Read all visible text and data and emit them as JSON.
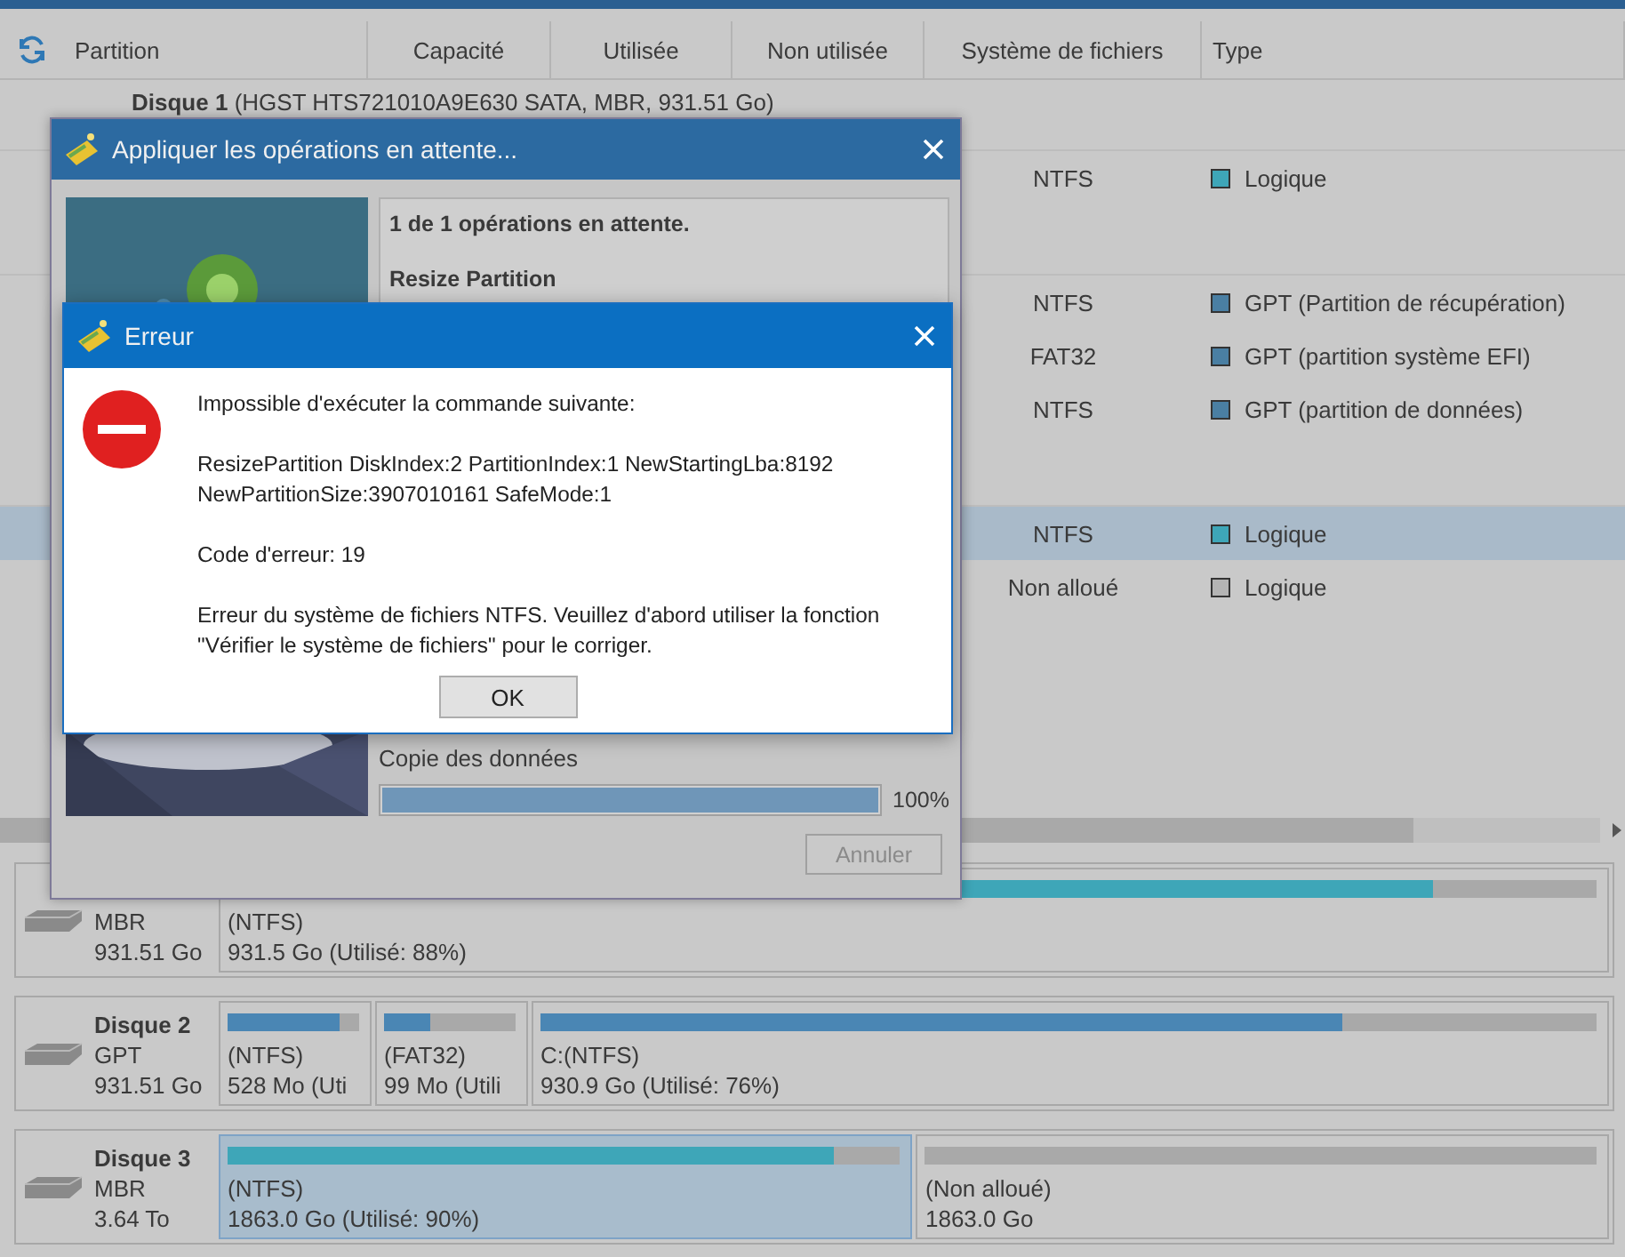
{
  "table": {
    "columns": [
      "Partition",
      "Capacité",
      "Utilisée",
      "Non utilisée",
      "Système de fichiers",
      "Type"
    ],
    "rows": [
      {
        "kind": "disk",
        "label": "Disque 1",
        "detail": "(HGST HTS721010A9E630 SATA, MBR, 931.51 Go)"
      },
      {
        "kind": "partition",
        "file_system": "NTFS",
        "type": "Logique",
        "color": "#3ea6b8",
        "selected": false
      },
      {
        "kind": "disk"
      },
      {
        "kind": "partition",
        "file_system": "NTFS",
        "type": "GPT (Partition de récupération)",
        "color": "#4a7fa3",
        "selected": false
      },
      {
        "kind": "partition",
        "file_system": "FAT32",
        "type": "GPT (partition système EFI)",
        "color": "#4a7fa3",
        "selected": false
      },
      {
        "kind": "partition",
        "file_system": "NTFS",
        "type": "GPT (partition de données)",
        "color": "#4a7fa3",
        "selected": false
      },
      {
        "kind": "disk"
      },
      {
        "kind": "partition",
        "file_system": "NTFS",
        "type": "Logique",
        "color": "#3ea6b8",
        "selected": true
      },
      {
        "kind": "partition",
        "file_system": "Non alloué",
        "type": "Logique",
        "color": "#b4b4b4",
        "selected": false
      }
    ]
  },
  "disk_map": [
    {
      "scheme": "MBR",
      "size": "931.51 Go",
      "partitions": [
        {
          "label": "(NTFS)",
          "detail": "931.5 Go (Utilisé: 88%)",
          "level": 0.88,
          "color": "#3ea6b8",
          "selected": false
        }
      ]
    },
    {
      "name": "Disque 2",
      "scheme": "GPT",
      "size": "931.51 Go",
      "partitions": [
        {
          "label": "(NTFS)",
          "detail": "528 Mo (Uti",
          "level": 0.85,
          "color": "#4a86b4",
          "selected": false
        },
        {
          "label": "(FAT32)",
          "detail": "99 Mo (Utili",
          "level": 0.35,
          "color": "#4a86b4",
          "selected": false
        },
        {
          "label": "C:(NTFS)",
          "detail": "930.9 Go (Utilisé: 76%)",
          "level": 0.76,
          "color": "#4a86b4",
          "selected": false
        }
      ]
    },
    {
      "name": "Disque 3",
      "scheme": "MBR",
      "size": "3.64 To",
      "partitions": [
        {
          "label": "(NTFS)",
          "detail": "1863.0 Go (Utilisé: 90%)",
          "level": 0.9,
          "color": "#3ea6b8",
          "selected": true
        },
        {
          "label": "(Non alloué)",
          "detail": "1863.0 Go",
          "selected": false
        }
      ]
    }
  ],
  "apply_dialog": {
    "title": "Appliquer les opérations en attente...",
    "summary": "1 de 1 opérations en attente.",
    "operation": "Resize Partition",
    "step": "Copie des données",
    "progress": {
      "level": 1,
      "reading": "100%"
    },
    "cancel": {
      "label": "Annuler",
      "disabled": true
    }
  },
  "error_dialog": {
    "title": "Erreur",
    "paragraphs": [
      "Impossible d'exécuter la commande suivante:",
      "ResizePartition DiskIndex:2 PartitionIndex:1 NewStartingLba:8192 NewPartitionSize:3907010161 SafeMode:1",
      "Code d'erreur: 19",
      "Erreur du système de fichiers NTFS. Veuillez d'abord utiliser la fonction \"Vérifier le système de fichiers\" pour le corriger."
    ],
    "ok": "OK"
  }
}
